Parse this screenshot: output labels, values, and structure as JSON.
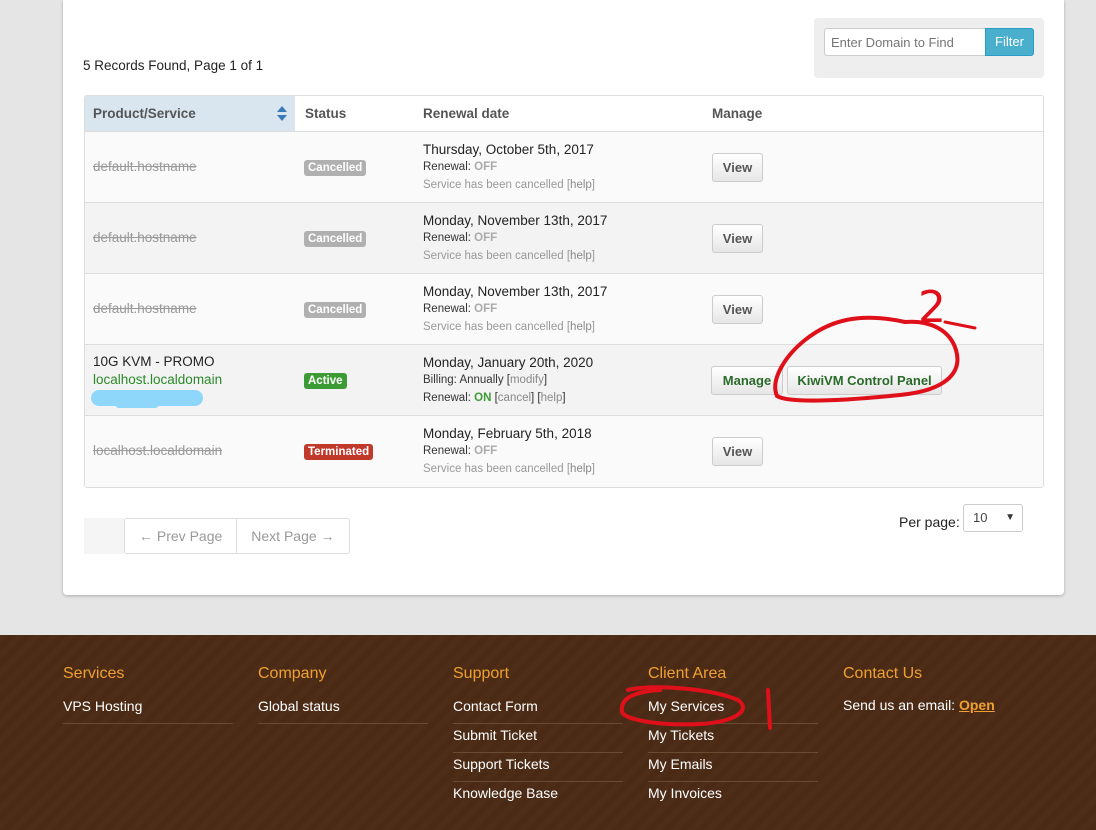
{
  "records": "5 Records Found, Page 1 of 1",
  "filter": {
    "placeholder": "Enter Domain to Find",
    "button": "Filter"
  },
  "table": {
    "headers": [
      "Product/Service",
      "Status",
      "Renewal date",
      "Manage"
    ],
    "rows": [
      {
        "product": "default.hostname",
        "status": "Cancelled",
        "date": "Thursday, October 5th, 2017",
        "renewal_label": "Renewal:",
        "renewal": "OFF",
        "note": "Service has been cancelled",
        "help": "help",
        "button": "View"
      },
      {
        "product": "default.hostname",
        "status": "Cancelled",
        "date": "Monday, November 13th, 2017",
        "renewal_label": "Renewal:",
        "renewal": "OFF",
        "note": "Service has been cancelled",
        "help": "help",
        "button": "View"
      },
      {
        "product": "default.hostname",
        "status": "Cancelled",
        "date": "Monday, November 13th, 2017",
        "renewal_label": "Renewal:",
        "renewal": "OFF",
        "note": "Service has been cancelled",
        "help": "help",
        "button": "View"
      },
      {
        "product": "10G KVM - PROMO",
        "domain": "localhost.localdomain",
        "status": "Active",
        "date": "Monday, January 20th, 2020",
        "billing_label": "Billing:",
        "billing": "Annually",
        "modify": "modify",
        "renewal_label": "Renewal:",
        "renewal": "ON",
        "cancel": "cancel",
        "help": "help",
        "button": "Manage",
        "button2": "KiwiVM Control Panel"
      },
      {
        "product": "localhost.localdomain",
        "status": "Terminated",
        "date": "Monday, February 5th, 2018",
        "renewal_label": "Renewal:",
        "renewal": "OFF",
        "note": "Service has been cancelled",
        "help": "help",
        "button": "View"
      }
    ]
  },
  "pagination": {
    "prev": "← Prev Page",
    "next": "Next Page →"
  },
  "per_page": {
    "label": "Per page:",
    "value": "10"
  },
  "footer": {
    "services": {
      "title": "Services",
      "links": [
        "VPS Hosting"
      ]
    },
    "company": {
      "title": "Company",
      "links": [
        "Global status"
      ]
    },
    "support": {
      "title": "Support",
      "links": [
        "Contact Form",
        "Submit Ticket",
        "Support Tickets",
        "Knowledge Base"
      ]
    },
    "client": {
      "title": "Client Area",
      "links": [
        "My Services",
        "My Tickets",
        "My Emails",
        "My Invoices"
      ]
    },
    "contact": {
      "title": "Contact Us",
      "text": "Send us an email:",
      "link": "Open"
    }
  },
  "annotations": {
    "one": "1",
    "two": "2"
  },
  "colors": {
    "accent": "#f0a030",
    "active": "#3d9b35",
    "terminated": "#c0392b",
    "annotation": "#e0101a"
  }
}
